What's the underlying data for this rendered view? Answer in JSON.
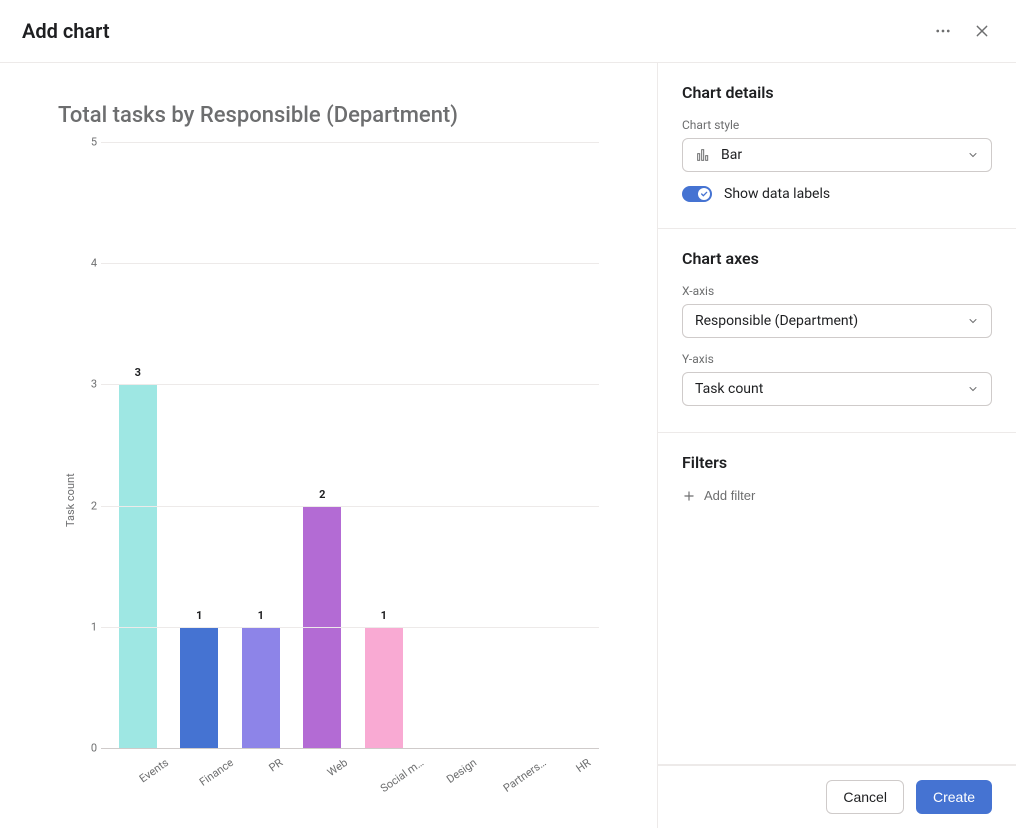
{
  "header": {
    "title": "Add chart"
  },
  "chart_data": {
    "type": "bar",
    "title": "Total tasks by Responsible (Department)",
    "ylabel": "Task count",
    "xlabel": "",
    "ylim": [
      0,
      5
    ],
    "yticks": [
      0,
      1,
      2,
      3,
      4,
      5
    ],
    "categories": [
      "Events",
      "Finance",
      "PR",
      "Web",
      "Social m…",
      "Design",
      "Partners…",
      "HR"
    ],
    "values": [
      3,
      1,
      1,
      2,
      1,
      0,
      0,
      0
    ],
    "colors": [
      "#9ee7e3",
      "#4573d2",
      "#8d84e8",
      "#b36bd4",
      "#f9aad3",
      "#cccccc",
      "#cccccc",
      "#cccccc"
    ],
    "show_data_labels": true
  },
  "details": {
    "section_title": "Chart details",
    "style_label": "Chart style",
    "style_value": "Bar",
    "show_labels_text": "Show data labels"
  },
  "axes": {
    "section_title": "Chart axes",
    "x_label": "X-axis",
    "x_value": "Responsible (Department)",
    "y_label": "Y-axis",
    "y_value": "Task count"
  },
  "filters": {
    "section_title": "Filters",
    "add_text": "Add filter"
  },
  "footer": {
    "cancel": "Cancel",
    "create": "Create"
  }
}
